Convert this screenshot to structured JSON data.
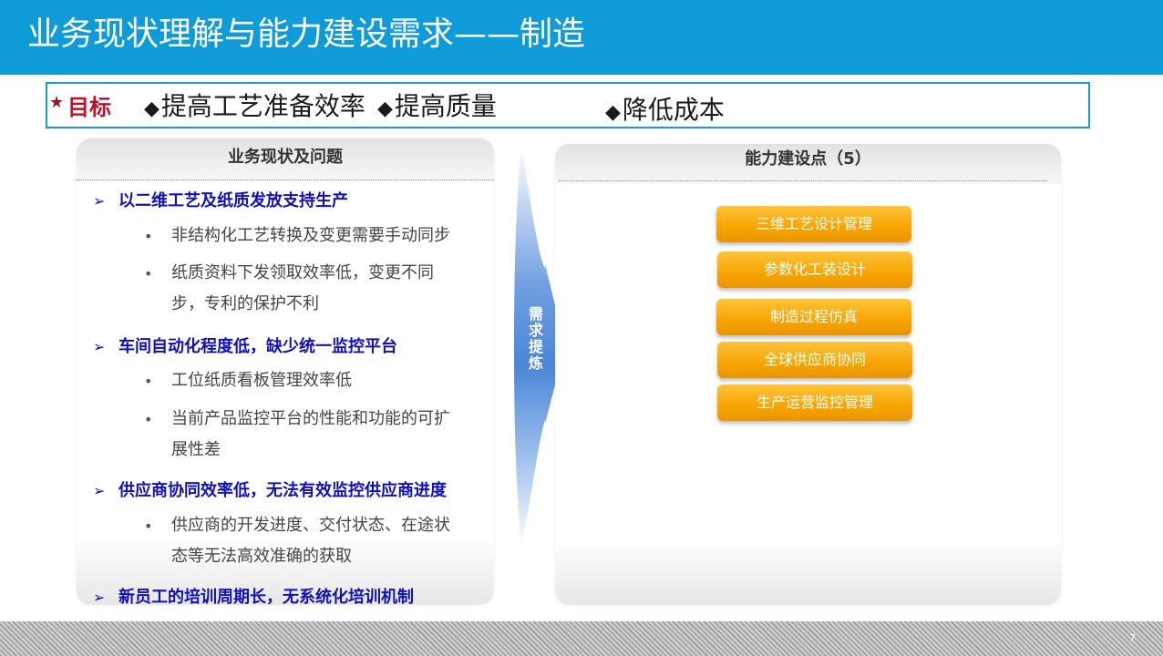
{
  "header": {
    "title": "业务现状理解与能力建设需求——制造"
  },
  "goals": {
    "label": "目标",
    "items": [
      "提高工艺准备效率",
      "提高质量",
      "降低成本"
    ],
    "bullet_symbol": "◆"
  },
  "left_panel": {
    "title": "业务现状及问题",
    "issues": [
      {
        "title": "以二维工艺及纸质发放支持生产",
        "subs": [
          "非结构化工艺转换及变更需要手动同步",
          "纸质资料下发领取效率低，变更不同步，专利的保护不利"
        ]
      },
      {
        "title": "车间自动化程度低，缺少统一监控平台",
        "subs": [
          "工位纸质看板管理效率低",
          "当前产品监控平台的性能和功能的可扩展性差"
        ]
      },
      {
        "title": "供应商协同效率低，无法有效监控供应商进度",
        "subs": [
          "供应商的开发进度、交付状态、在途状态等无法高效准确的获取"
        ]
      },
      {
        "title": "新员工的培训周期长，无系统化培训机制",
        "subs": []
      }
    ]
  },
  "arrow": {
    "label": "需求提炼"
  },
  "right_panel": {
    "title": "能力建设点（5）",
    "capabilities": [
      "三维工艺设计管理",
      "参数化工装设计",
      "制造过程仿真",
      "全球供应商协同",
      "生产运营监控管理"
    ]
  },
  "footer": {
    "page_number": "7"
  },
  "colors": {
    "header_bg": "#0e9bd8",
    "accent_orange": "#f7a400",
    "issue_blue": "#1010b8",
    "goal_red": "#c0102a"
  },
  "icons": {
    "goal": "star-icon",
    "issue": "arrow-bullet-icon",
    "goal_item": "diamond-icon"
  }
}
